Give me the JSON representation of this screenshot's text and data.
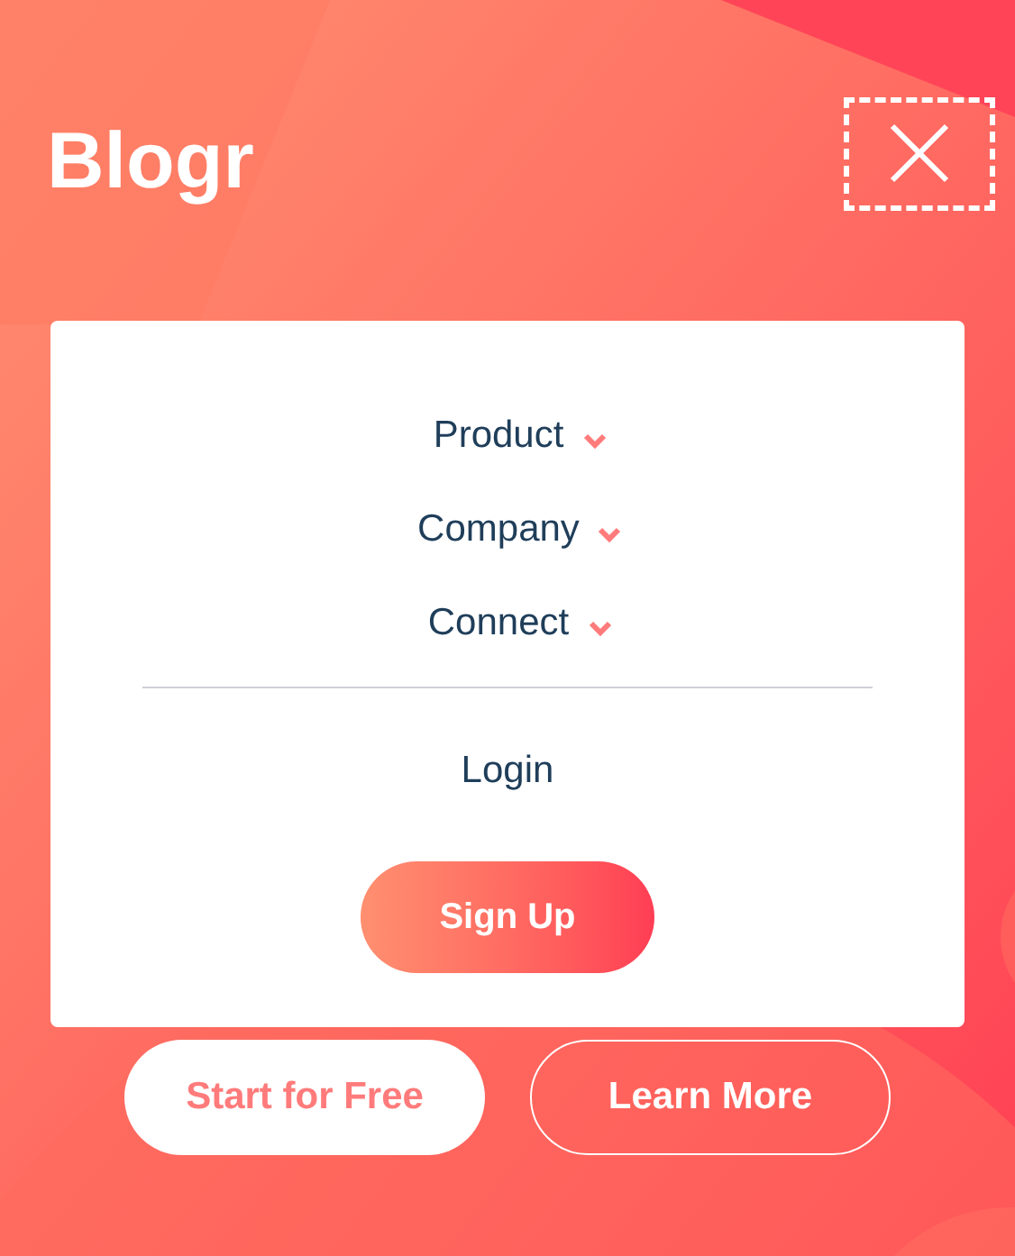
{
  "header": {
    "logo": "Blogr"
  },
  "menu": {
    "items": [
      {
        "label": "Product"
      },
      {
        "label": "Company"
      },
      {
        "label": "Connect"
      }
    ],
    "login": "Login",
    "signup": "Sign Up"
  },
  "hero_buttons": [
    {
      "label": "Start for Free",
      "kind": "filled"
    },
    {
      "label": "Learn More",
      "kind": "outline"
    }
  ]
}
